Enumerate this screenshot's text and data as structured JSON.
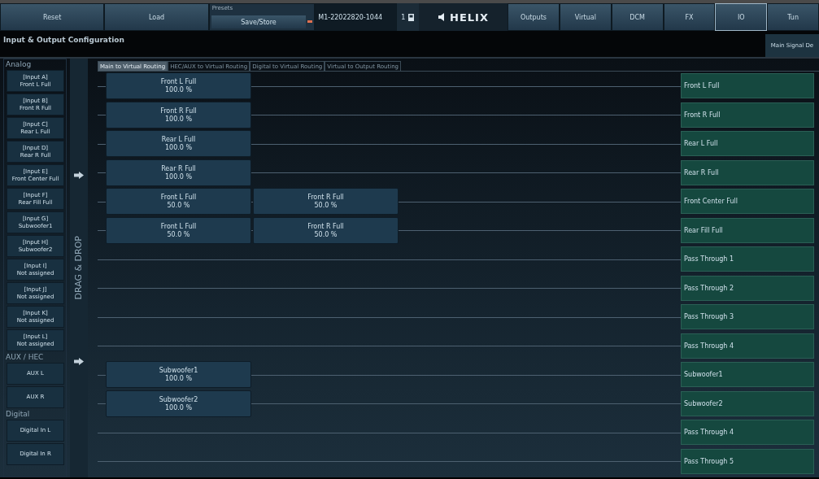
{
  "toolbar": {
    "actions": [
      "Reset",
      "Load"
    ],
    "preset": {
      "label": "Presets",
      "value": "Save/Store"
    },
    "serial": "M1-22022820-1044",
    "slot": "1",
    "logo": "HELIX",
    "nav": [
      {
        "label": "Outputs",
        "selected": false
      },
      {
        "label": "Virtual",
        "selected": false
      },
      {
        "label": "DCM",
        "selected": false
      },
      {
        "label": "FX",
        "selected": false
      },
      {
        "label": "IO",
        "selected": true
      },
      {
        "label": "Tun",
        "selected": false
      }
    ]
  },
  "page_title": "Input & Output Configuration",
  "side_button": "Main Signal De",
  "sidebar": {
    "groups": [
      {
        "title": "Analog",
        "items": [
          [
            "[Input A]",
            "Front L Full"
          ],
          [
            "[Input B]",
            "Front R Full"
          ],
          [
            "[Input C]",
            "Rear L Full"
          ],
          [
            "[Input D]",
            "Rear R Full"
          ],
          [
            "[Input E]",
            "Front Center Full"
          ],
          [
            "[Input F]",
            "Rear Fill Full"
          ],
          [
            "[Input G]",
            "Subwoofer1"
          ],
          [
            "[Input H]",
            "Subwoofer2"
          ],
          [
            "[Input I]",
            "Not assigned"
          ],
          [
            "[Input J]",
            "Not assigned"
          ],
          [
            "[Input K]",
            "Not assigned"
          ],
          [
            "[Input L]",
            "Not assigned"
          ]
        ]
      },
      {
        "title": "AUX / HEC",
        "items": [
          [
            "AUX L"
          ],
          [
            "AUX R"
          ]
        ]
      },
      {
        "title": "Digital",
        "items": [
          [
            "Digital In L"
          ],
          [
            "Digital In R"
          ]
        ]
      }
    ]
  },
  "drag_label": "DRAG & DROP",
  "tabs": [
    {
      "label": "Main to Virtual Routing",
      "selected": true
    },
    {
      "label": "HEC/AUX to Virtual Routing",
      "selected": false
    },
    {
      "label": "Digital to Virtual Routing",
      "selected": false
    },
    {
      "label": "Virtual to Output Routing",
      "selected": false
    }
  ],
  "rows": [
    {
      "sources": [
        {
          "name": "Front L Full",
          "share": "100.0 %"
        }
      ],
      "output": "Front L Full"
    },
    {
      "sources": [
        {
          "name": "Front R Full",
          "share": "100.0 %"
        }
      ],
      "output": "Front R Full"
    },
    {
      "sources": [
        {
          "name": "Rear L Full",
          "share": "100.0 %"
        }
      ],
      "output": "Rear L Full"
    },
    {
      "sources": [
        {
          "name": "Rear R Full",
          "share": "100.0 %"
        }
      ],
      "output": "Rear R Full"
    },
    {
      "sources": [
        {
          "name": "Front L Full",
          "share": "50.0 %"
        },
        {
          "name": "Front R Full",
          "share": "50.0 %"
        }
      ],
      "output": "Front Center Full"
    },
    {
      "sources": [
        {
          "name": "Front L Full",
          "share": "50.0 %"
        },
        {
          "name": "Front R Full",
          "share": "50.0 %"
        }
      ],
      "output": "Rear Fill Full"
    },
    {
      "sources": [],
      "output": "Pass Through 1"
    },
    {
      "sources": [],
      "output": "Pass Through 2"
    },
    {
      "sources": [],
      "output": "Pass Through 3"
    },
    {
      "sources": [],
      "output": "Pass Through 4"
    },
    {
      "sources": [
        {
          "name": "Subwoofer1",
          "share": "100.0 %"
        }
      ],
      "output": "Subwoofer1"
    },
    {
      "sources": [
        {
          "name": "Subwoofer2",
          "share": "100.0 %"
        }
      ],
      "output": "Subwoofer2"
    },
    {
      "sources": [],
      "output": "Pass Through 4"
    },
    {
      "sources": [],
      "output": "Pass Through 5"
    }
  ]
}
